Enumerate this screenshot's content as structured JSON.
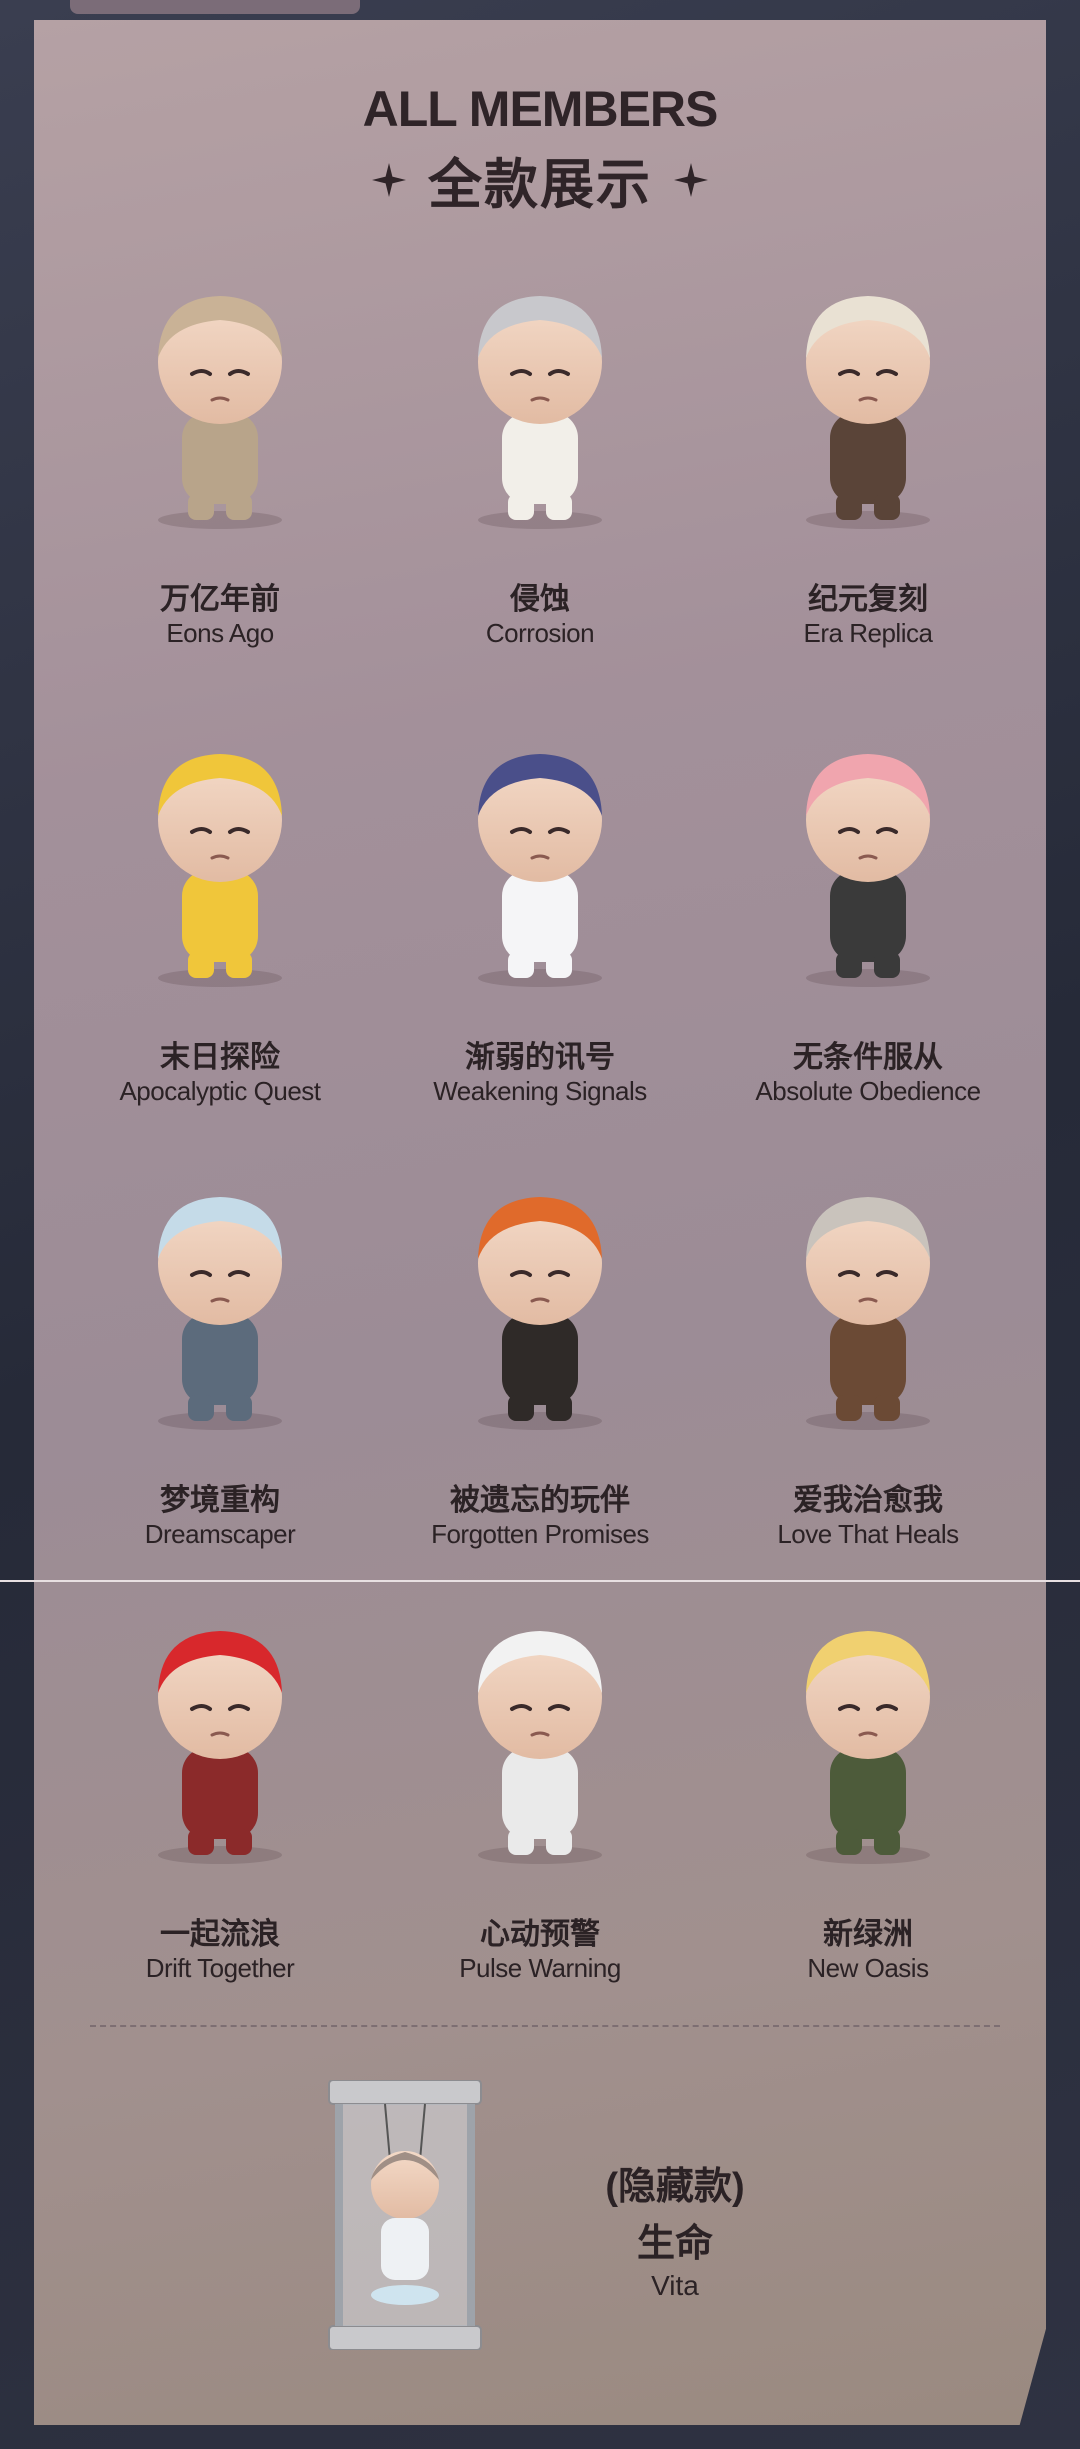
{
  "header": {
    "title_en": "ALL MEMBERS",
    "title_cn": "全款展示"
  },
  "members": [
    {
      "cn": "万亿年前",
      "en": "Eons Ago",
      "figure": "hooded-baby-figure"
    },
    {
      "cn": "侵蚀",
      "en": "Corrosion",
      "figure": "silver-helmet-figure"
    },
    {
      "cn": "纪元复刻",
      "en": "Era Replica",
      "figure": "skull-hat-figure"
    },
    {
      "cn": "末日探险",
      "en": "Apocalyptic Quest",
      "figure": "yellow-hood-figure"
    },
    {
      "cn": "渐弱的讯号",
      "en": "Weakening Signals",
      "figure": "astronaut-figure"
    },
    {
      "cn": "无条件服从",
      "en": "Absolute Obedience",
      "figure": "pink-hair-figure"
    },
    {
      "cn": "梦境重构",
      "en": "Dreamscaper",
      "figure": "goggles-figure"
    },
    {
      "cn": "被遗忘的玩伴",
      "en": "Forgotten Promises",
      "figure": "cone-hat-figure"
    },
    {
      "cn": "爱我治愈我",
      "en": "Love That Heals",
      "figure": "stump-sitting-figure"
    },
    {
      "cn": "一起流浪",
      "en": "Drift Together",
      "figure": "red-hair-figure"
    },
    {
      "cn": "心动预警",
      "en": "Pulse Warning",
      "figure": "robot-helmet-figure"
    },
    {
      "cn": "新绿洲",
      "en": "New Oasis",
      "figure": "headphones-figure"
    }
  ],
  "hidden": {
    "label": "(隐藏款)",
    "cn": "生命",
    "en": "Vita",
    "figure": "capsule-figure"
  },
  "colors": {
    "panel": "#a79399",
    "text": "#2b2225",
    "page_background": "#2e3140"
  }
}
